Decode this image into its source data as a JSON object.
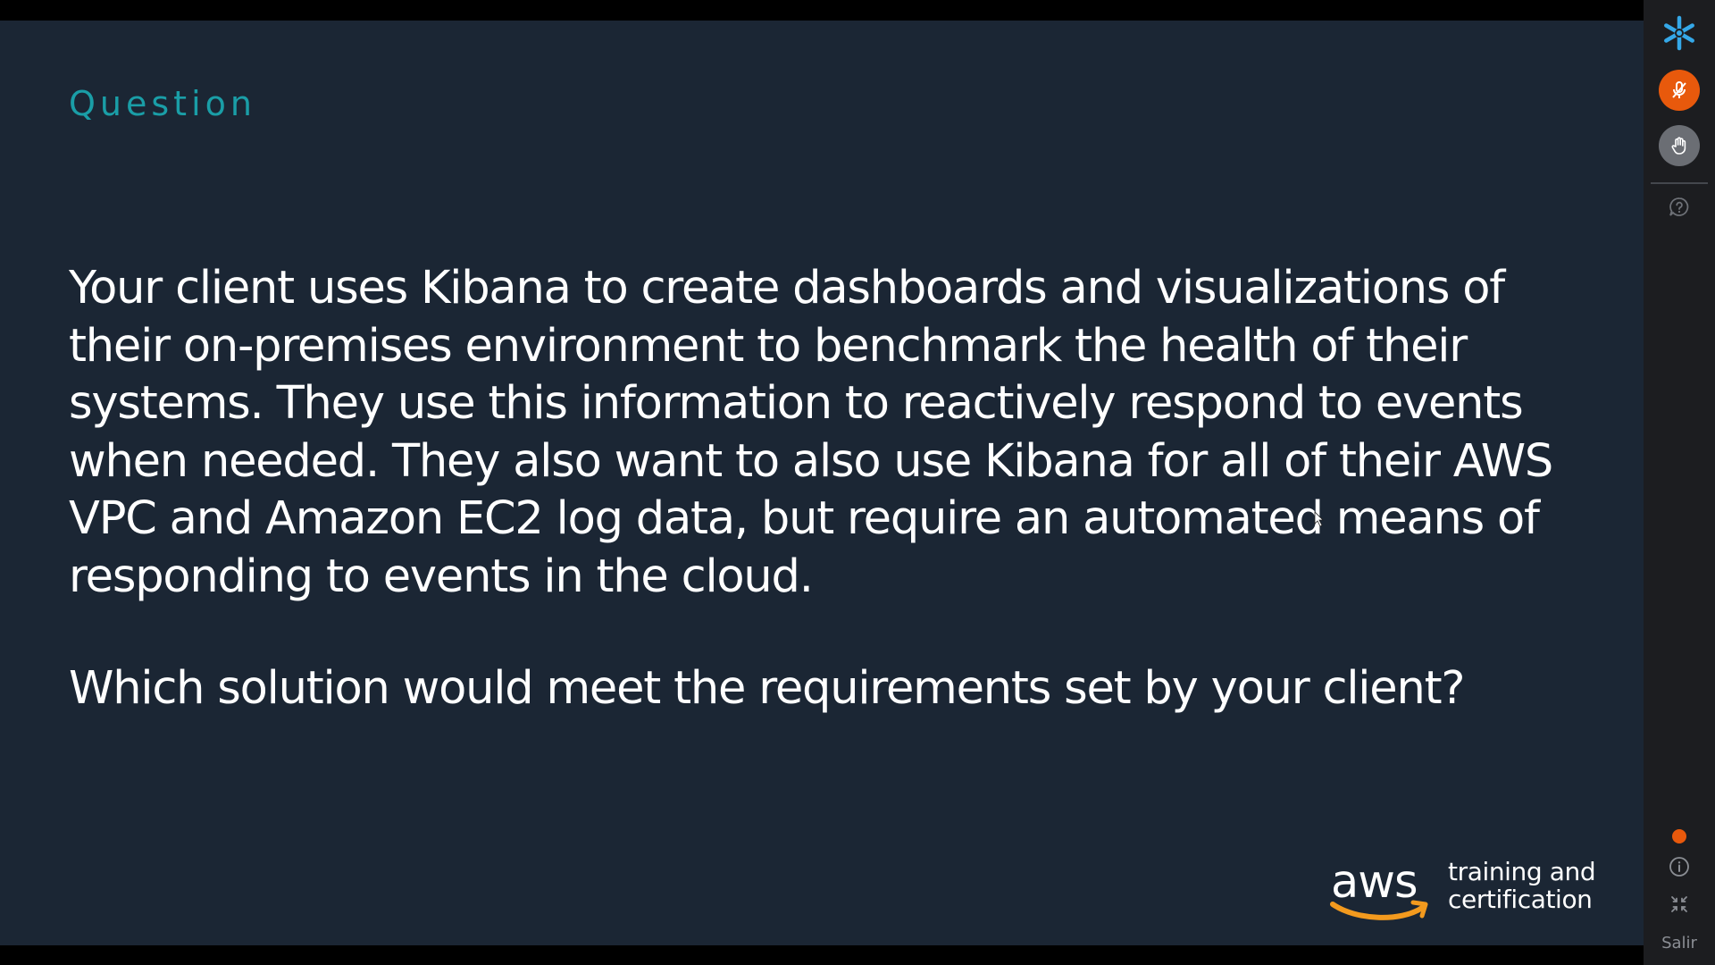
{
  "slide": {
    "title": "Question",
    "question": "Your client uses Kibana to create dashboards and visualizations of their on-premises environment to benchmark the health of their systems. They use this information to reactively respond to events when needed. They also want to also use Kibana for all of their AWS VPC and Amazon EC2 log data, but require an automated means of responding to events in the cloud.",
    "prompt": "Which solution would meet the requirements set by your client?",
    "brand": {
      "wordmark": "aws",
      "tagline": "training and certification"
    }
  },
  "sidebar": {
    "icons": [
      "snowflake-logo-icon",
      "microphone-icon",
      "raise-hand-icon",
      "help-icon",
      "status-dot",
      "info-icon",
      "collapse-icon"
    ],
    "exit_label": "Salir"
  },
  "colors": {
    "slide_background": "#1b2634",
    "title_accent": "#1a9ea7",
    "sidebar_background": "#1c1d20",
    "mic_active": "#e8590c",
    "brand_smile": "#f39a1e",
    "logo": "#35a8e8"
  }
}
